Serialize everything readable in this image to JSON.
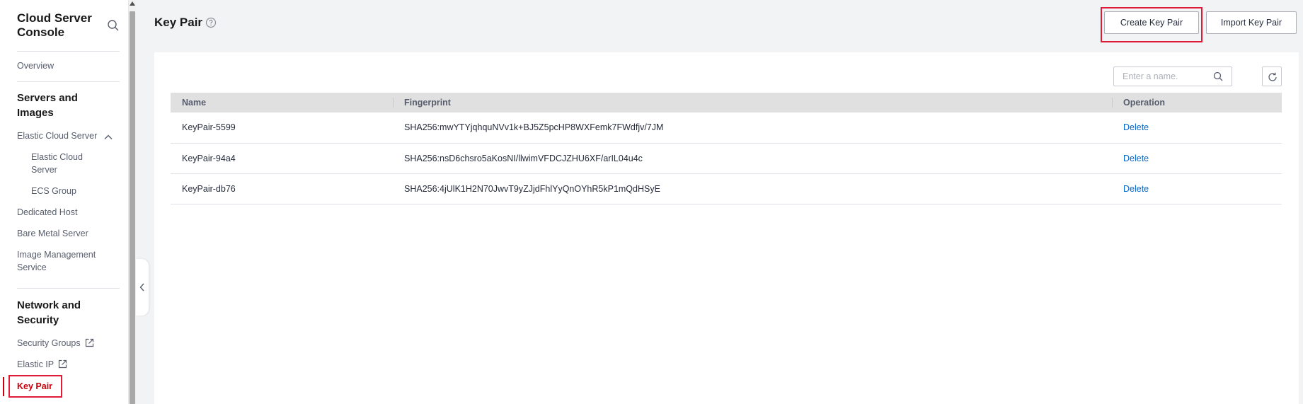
{
  "sidebar": {
    "title": "Cloud Server Console",
    "overview": "Overview",
    "groups": {
      "servers": "Servers and Images",
      "network": "Network and Security"
    },
    "items": {
      "ecs": "Elastic Cloud Server",
      "ecs_sub": "Elastic Cloud Server",
      "ecs_group": "ECS Group",
      "dedicated_host": "Dedicated Host",
      "bare_metal": "Bare Metal Server",
      "ims": "Image Management Service",
      "security_groups": "Security Groups",
      "elastic_ip": "Elastic IP",
      "key_pair": "Key Pair"
    },
    "active_color": "#c7000b"
  },
  "header": {
    "title": "Key Pair",
    "create_label": "Create Key Pair",
    "import_label": "Import Key Pair"
  },
  "search": {
    "placeholder": "Enter a name."
  },
  "table": {
    "columns": [
      "Name",
      "Fingerprint",
      "Operation"
    ],
    "rows": [
      {
        "name": "KeyPair-5599",
        "fingerprint": "SHA256:mwYTYjqhquNVv1k+BJ5Z5pcHP8WXFemk7FWdfjv/7JM",
        "operation": "Delete"
      },
      {
        "name": "KeyPair-94a4",
        "fingerprint": "SHA256:nsD6chsro5aKosNI/llwimVFDCJZHU6XF/arIL04u4c",
        "operation": "Delete"
      },
      {
        "name": "KeyPair-db76",
        "fingerprint": "SHA256:4jUlK1H2N70JwvT9yZJjdFhlYyQnOYhR5kP1mQdHSyE",
        "operation": "Delete"
      }
    ]
  },
  "colors": {
    "highlight": "#e11a37",
    "link": "#0066cc"
  }
}
